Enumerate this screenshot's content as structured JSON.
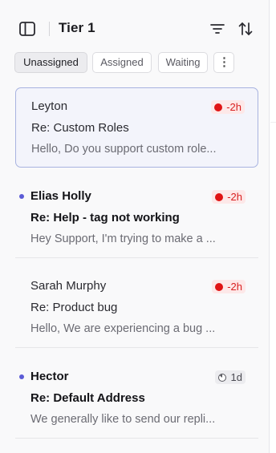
{
  "header": {
    "title": "Tier 1",
    "icons": {
      "sidebar": "sidebar-toggle-icon",
      "filter": "filter-icon",
      "sort": "sort-icon"
    }
  },
  "tabs": [
    {
      "label": "Unassigned",
      "active": true
    },
    {
      "label": "Assigned",
      "active": false
    },
    {
      "label": "Waiting",
      "active": false
    },
    {
      "label": "⋮",
      "active": false
    }
  ],
  "conversations": [
    {
      "name": "Leyton",
      "subject": "Re: Custom Roles",
      "preview": "Hello, Do you support custom role...",
      "badge": "-2h",
      "badge_type": "overdue",
      "unread": false,
      "selected": true
    },
    {
      "name": "Elias Holly",
      "subject": "Re: Help - tag not working",
      "preview": "Hey Support, I'm trying to make a ...",
      "badge": "-2h",
      "badge_type": "overdue",
      "unread": true,
      "selected": false
    },
    {
      "name": "Sarah Murphy",
      "subject": "Re: Product bug",
      "preview": "Hello, We are experiencing a bug ...",
      "badge": "-2h",
      "badge_type": "overdue",
      "unread": false,
      "selected": false
    },
    {
      "name": "Hector",
      "subject": "Re: Default Address",
      "preview": "We generally like to send our repli...",
      "badge": "1d",
      "badge_type": "ok",
      "unread": true,
      "selected": false
    }
  ],
  "colors": {
    "accent": "#5b5bd6",
    "overdue": "#e01414",
    "selected_border": "#a8b3e0"
  }
}
